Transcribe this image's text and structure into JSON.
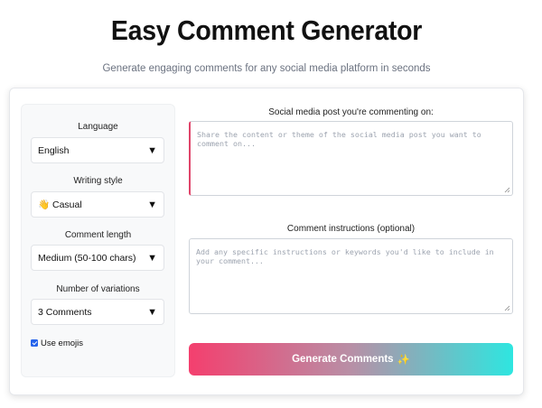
{
  "header": {
    "title": "Easy Comment Generator",
    "subtitle": "Generate engaging comments for any social media platform in seconds"
  },
  "options": {
    "language": {
      "label": "Language",
      "value": "English"
    },
    "writing_style": {
      "label": "Writing style",
      "emoji": "👋",
      "value": "Casual"
    },
    "comment_length": {
      "label": "Comment length",
      "value": "Medium (50-100 chars)"
    },
    "variations": {
      "label": "Number of variations",
      "value": "3 Comments"
    },
    "use_emojis": {
      "label": "Use emojis",
      "checked": true
    },
    "caret": "▼"
  },
  "post": {
    "label": "Social media post you're commenting on:",
    "placeholder": "Share the content or theme of the social media post you want to comment on..."
  },
  "instructions": {
    "label": "Comment instructions (optional)",
    "placeholder": "Add any specific instructions or keywords you'd like to include in your comment..."
  },
  "generate": {
    "label": "Generate Comments",
    "icon": "✨"
  },
  "colors": {
    "gradient_start": "#f43f6e",
    "gradient_end": "#2ee6e0",
    "checkbox": "#2563eb",
    "focus_accent": "#e0446a"
  }
}
